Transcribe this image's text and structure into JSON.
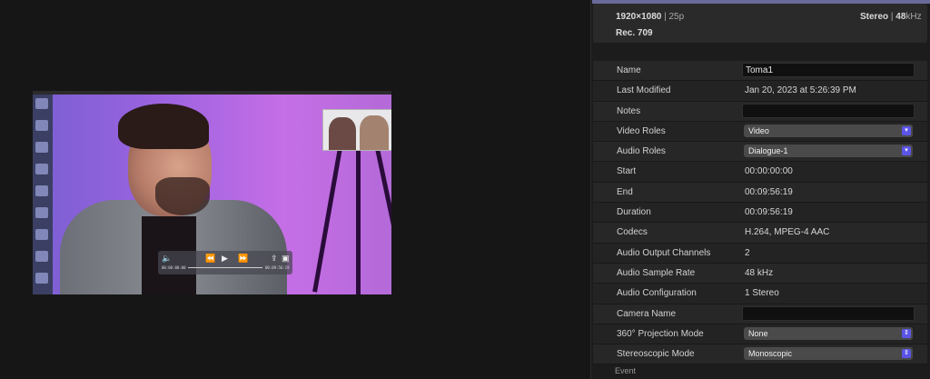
{
  "summary": {
    "resolution": "1920×1080",
    "framerate": "25p",
    "audio_channels": "Stereo",
    "sample_rate": "48",
    "sample_unit": "kHz",
    "color_space": "Rec. 709"
  },
  "player": {
    "timecode_start": "00:00:00:00",
    "timecode_end": "00:09:56:19"
  },
  "properties": [
    {
      "label": "Name",
      "type": "field",
      "value": "Toma1"
    },
    {
      "label": "Last Modified",
      "type": "text",
      "value": "Jan 20, 2023 at 5:26:39 PM"
    },
    {
      "label": "Notes",
      "type": "field",
      "value": ""
    },
    {
      "label": "Video Roles",
      "type": "popup",
      "value": "Video"
    },
    {
      "label": "Audio Roles",
      "type": "popup",
      "value": "Dialogue-1"
    },
    {
      "label": "Start",
      "type": "text",
      "value": "00:00:00:00"
    },
    {
      "label": "End",
      "type": "text",
      "value": "00:09:56:19"
    },
    {
      "label": "Duration",
      "type": "text",
      "value": "00:09:56:19"
    },
    {
      "label": "Codecs",
      "type": "text",
      "value": "H.264, MPEG-4 AAC"
    },
    {
      "label": "Audio Output Channels",
      "type": "text",
      "value": "2"
    },
    {
      "label": "Audio Sample Rate",
      "type": "text",
      "value": "48 kHz"
    },
    {
      "label": "Audio Configuration",
      "type": "text",
      "value": "1 Stereo"
    },
    {
      "label": "Camera Name",
      "type": "field",
      "value": ""
    },
    {
      "label": "360° Projection Mode",
      "type": "popup",
      "value": "None"
    },
    {
      "label": "Stereoscopic Mode",
      "type": "popup",
      "value": "Monoscopic"
    }
  ],
  "section_event": "Event",
  "colors": {
    "accent": "#5b55e6",
    "background": "#141414",
    "row": "#232323"
  }
}
